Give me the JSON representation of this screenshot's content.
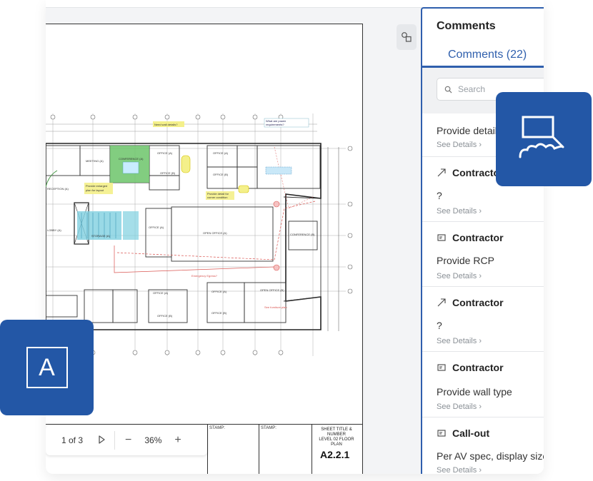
{
  "viewer": {
    "pagination": {
      "current": "1 of 3"
    },
    "zoom": {
      "value": "36%",
      "minus": "−",
      "plus": "+"
    }
  },
  "drawing": {
    "sheet_number": "A2.2.1",
    "sheet_title": "LEVEL 02 FLOOR PLAN",
    "sheet_caption": "SHEET TITLE & NUMBER",
    "stamp_1": "STAMP:",
    "stamp_2": "STAMP:",
    "rooms": {
      "conference_a": "CONFERENCE (A)",
      "office_a": "OFFICE (A)",
      "office_b": "OFFICE (B)",
      "open_office_a": "OPEN OFFICE (A)",
      "open_office_b": "OPEN OFFICE (B)",
      "conference_b": "CONFERENCE (B)",
      "meeting": "MEETING (A)",
      "reception": "RECEPTION (A)",
      "lobby": "LOBBY (A)"
    },
    "notes": {
      "wall_details": "Need wall details?",
      "power": "What are power requirements for Open Office areas?",
      "enlarged": "Provide enlarged plan for layout",
      "corner": "Provide detail for corner condition",
      "egress": "Emergency Egress?",
      "furniture": "See furniture plan for Open Office area layout"
    }
  },
  "panel": {
    "title": "Comments",
    "tab_label": "Comments (22)",
    "search_placeholder": "Search",
    "comments": [
      {
        "author": "",
        "body": "Provide details",
        "link": "See Details"
      },
      {
        "author": "Contractor",
        "body": "?",
        "link": "See Details",
        "icon": "arrow-icon"
      },
      {
        "author": "Contractor",
        "body": "Provide RCP",
        "link": "See Details",
        "icon": "comment-box-icon"
      },
      {
        "author": "Contractor",
        "body": "?",
        "link": "See Details",
        "icon": "arrow-icon"
      },
      {
        "author": "Contractor",
        "body": "Provide wall type",
        "link": "See Details",
        "icon": "comment-box-icon"
      },
      {
        "author": "Call-out",
        "body": "Per AV spec, display size i",
        "link": "See Details",
        "icon": "comment-box-icon"
      }
    ]
  },
  "badges": {
    "text_tool_letter": "A",
    "text_tool_icon": "text-tool-icon",
    "callout_tool_icon": "cloud-callout-icon"
  },
  "colors": {
    "accent": "#2357a6",
    "panel_border": "#2f5fad",
    "room_green": "#6cc46a",
    "room_cyan": "#7fd0e0",
    "note_yellow": "#f4f08a",
    "redline": "#d9534f"
  }
}
